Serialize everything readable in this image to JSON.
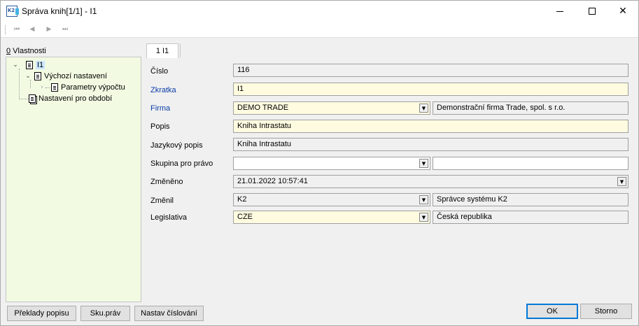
{
  "window": {
    "title": "Správa knih[1/1] - I1",
    "app_icon_text": "K2",
    "buttons": {
      "minimize": "minimize-icon",
      "maximize": "maximize-icon",
      "close": "close-icon"
    }
  },
  "navigation": {
    "first": "⏮",
    "prev": "◀",
    "next": "▶",
    "last": "⏭"
  },
  "properties": {
    "label_underlined": "0",
    "label_rest": " Vlastnosti",
    "tree": [
      {
        "label": "I1",
        "level": 0,
        "expanded": true,
        "selected": true
      },
      {
        "label": "Výchozí nastavení",
        "level": 1,
        "expanded": true,
        "selected": false
      },
      {
        "label": "Parametry výpočtu",
        "level": 2,
        "expanded": false,
        "selected": false
      },
      {
        "label": "Nastavení pro období",
        "level": 1,
        "expanded": null,
        "selected": false
      }
    ]
  },
  "tab": {
    "label": "1 I1"
  },
  "form": {
    "cislo": {
      "label": "Číslo",
      "value": "116"
    },
    "zkratka": {
      "label": "Zkratka",
      "value": "I1"
    },
    "firma": {
      "label": "Firma",
      "value": "DEMO TRADE",
      "description": "Demonstrační firma Trade, spol. s r.o."
    },
    "popis": {
      "label": "Popis",
      "value": "Kniha Intrastatu"
    },
    "jazykovy_popis": {
      "label": "Jazykový popis",
      "value": "Kniha Intrastatu"
    },
    "skupina": {
      "label": "Skupina pro právo",
      "value": "",
      "description": ""
    },
    "zmeneno": {
      "label": "Změněno",
      "value": "21.01.2022 10:57:41"
    },
    "zmenil": {
      "label": "Změnil",
      "value": "K2",
      "description": "Správce systému K2"
    },
    "legislativa": {
      "label": "Legislativa",
      "value": "CZE",
      "description": "Česká republika"
    }
  },
  "bottom_buttons": {
    "preklady": "Překlady popisu",
    "sku_prav": "Sku.práv",
    "nastav_cislovani": "Nastav číslování",
    "ok": "OK",
    "storno": "Storno"
  },
  "colors": {
    "tree_bg": "#f2fbe2",
    "required_label": "#0a3ca8",
    "editable_field": "#fffbe0",
    "readonly_field": "#f0f0f0",
    "selection": "#cce8ff",
    "default_button_border": "#0078d7"
  }
}
